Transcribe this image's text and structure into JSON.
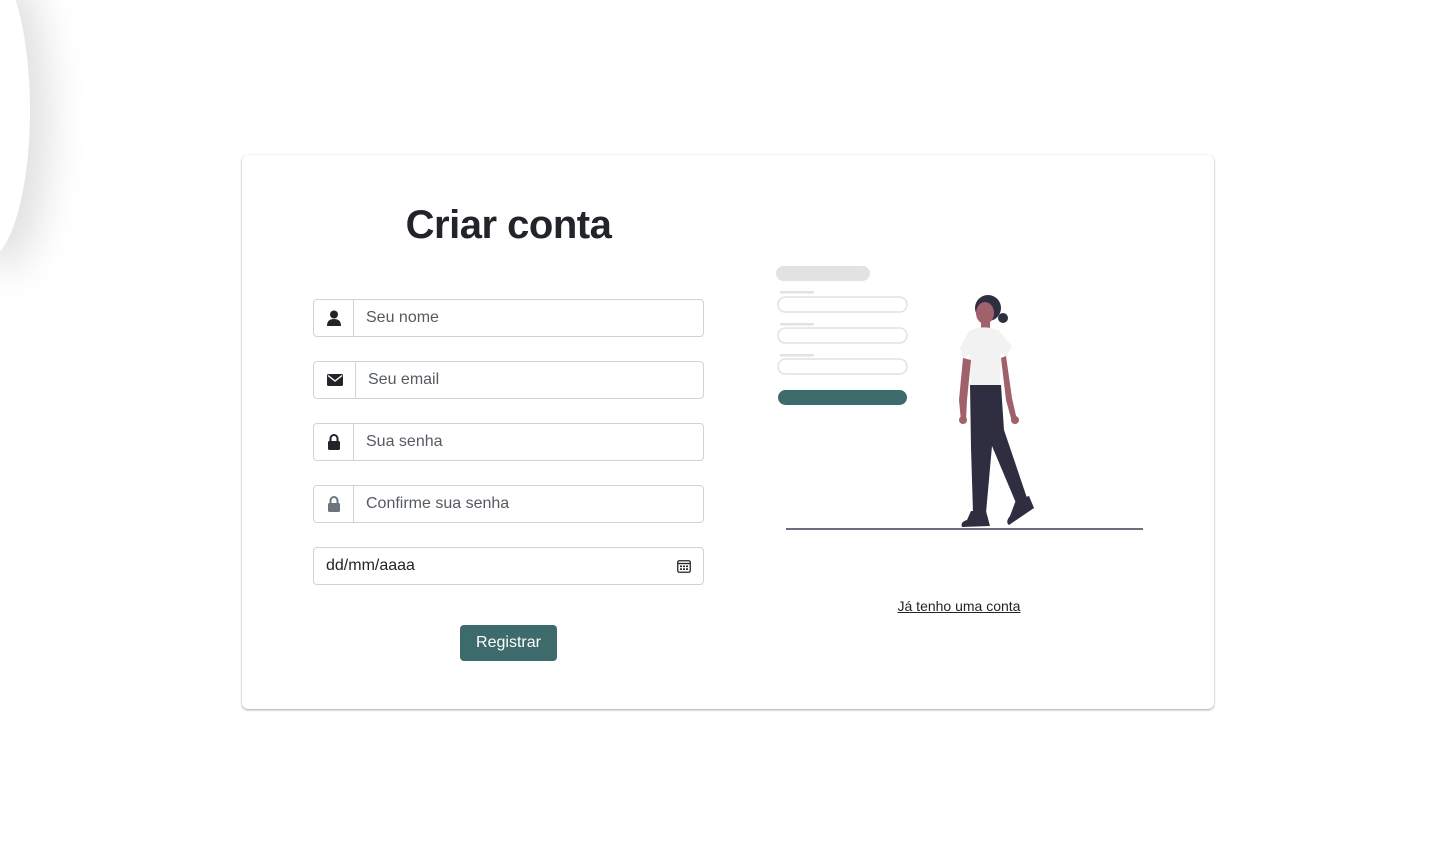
{
  "form": {
    "title": "Criar conta",
    "name_placeholder": "Seu nome",
    "email_placeholder": "Seu email",
    "password_placeholder": "Sua senha",
    "confirm_password_placeholder": "Confirme sua senha",
    "date_placeholder": "dd/mm/aaaa",
    "submit_label": "Registrar"
  },
  "aside": {
    "login_link": "Já tenho uma conta"
  },
  "icons": {
    "name": "user-icon",
    "email": "envelope-icon",
    "password": "lock-icon",
    "confirm_password": "lock-icon",
    "date": "calendar-icon"
  },
  "colors": {
    "accent": "#3d6b6c",
    "text": "#212529",
    "border": "#ced4da",
    "confirm_lock": "#6c757d"
  }
}
